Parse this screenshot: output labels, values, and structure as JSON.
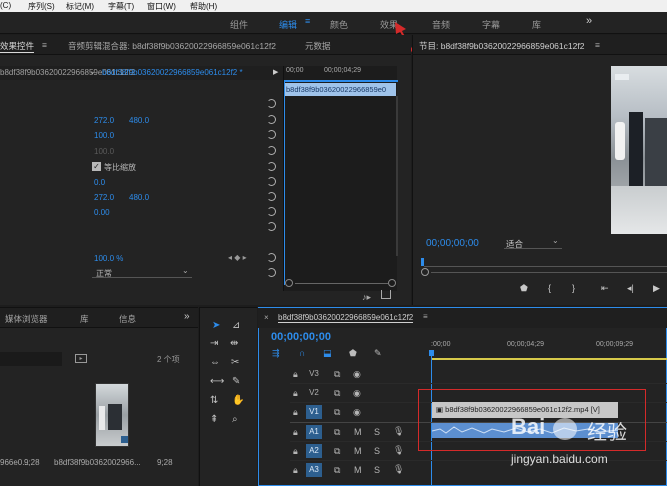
{
  "menu": [
    "(C)",
    "序列(S)",
    "标记(M)",
    "字幕(T)",
    "窗口(W)",
    "帮助(H)"
  ],
  "workspace": {
    "tabs": [
      "组件",
      "编辑",
      "颜色",
      "效果",
      "音频",
      "字幕",
      "库"
    ],
    "active_index": 1,
    "more": "»"
  },
  "effect_controls": {
    "tabs": [
      "效果控件",
      "音频剪辑混合器: b8df38f9b03620022966859e061c12f2",
      "元数据"
    ],
    "clip_name": "b8df38f9b03620022966859e061c12f2",
    "sequence_clip": "b8df38f9b03620022966859e061c12f2 *",
    "values": {
      "position_x": "272.0",
      "position_y": "480.0",
      "scale": "100.0",
      "scale_width": "100.0",
      "uniform_scale": "等比缩放",
      "rotation": "0.0",
      "anchor_x": "272.0",
      "anchor_y": "480.0",
      "anti_flicker": "0.00",
      "opacity": "100.0 %",
      "blend_mode": "正常"
    },
    "mini_timeline": {
      "t0": "00;00",
      "t1": "00;00;04;29",
      "clip": "b8df38f9b03620022966859e0"
    }
  },
  "program": {
    "title": "节目: b8df38f9b03620022966859e061c12f2",
    "timecode": "00;00;00;00",
    "fit": "适合"
  },
  "project": {
    "tabs": [
      "媒体浏览器",
      "库",
      "信息"
    ],
    "count": "2 个项",
    "items": [
      {
        "name": "966e0...",
        "duration": "9;28"
      },
      {
        "name": "b8df38f9b0362002966...",
        "duration": "9;28"
      }
    ]
  },
  "timeline": {
    "sequence": "b8df38f9b03620022966859e061c12f2",
    "timecode": "00;00;00;00",
    "ruler": [
      ":00;00",
      "00;00;04;29",
      "00;00;09;29"
    ],
    "video_tracks": [
      "V3",
      "V2",
      "V1"
    ],
    "audio_tracks": [
      "A1",
      "A2",
      "A3"
    ],
    "mute": "M",
    "solo": "S",
    "video_clip": "b8df38f9b03620022966859e061c12f2.mp4 [V]"
  },
  "watermark": {
    "text1": "Bai",
    "text2": "经验",
    "url": "jingyan.baidu.com"
  },
  "colors": {
    "accent": "#2d8ceb",
    "clip_audio": "#5c8fd0",
    "clip_video": "#c7c7c7",
    "highlight_box": "#d42a2a"
  }
}
